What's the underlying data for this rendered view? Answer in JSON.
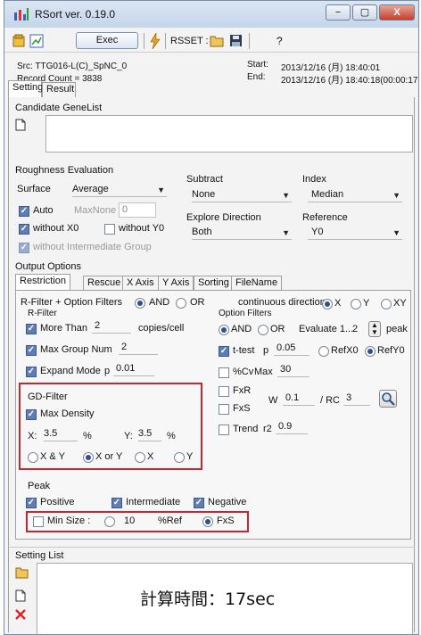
{
  "window": {
    "title": "RSort ver. 0.19.0",
    "minimize": "−",
    "maximize": "▢",
    "close": "X"
  },
  "toolbar": {
    "exec_label": "Exec",
    "rsset_label": "RSSET :",
    "help_label": "?"
  },
  "info": {
    "src": "Src: TTG016-L(C)_SpNC_0",
    "record_count": "Record Count = 3838",
    "start_label": "Start:",
    "start_value": "2013/12/16 (月) 18:40:01",
    "end_label": "End:",
    "end_value": "2013/12/16 (月) 18:40:18(00:00:17"
  },
  "main_tabs": [
    "Setting",
    "Result"
  ],
  "candidate": {
    "label": "Candidate GeneList"
  },
  "roughness": {
    "label": "Roughness Evaluation",
    "surface_label": "Surface",
    "surface_value": "Average",
    "auto_label": "Auto",
    "maxnone_label": "MaxNone",
    "maxnone_value": "0",
    "without_x0": "without X0",
    "without_y0": "without Y0",
    "without_intermediate": "without Intermediate Group",
    "subtract_label": "Subtract",
    "subtract_value": "None",
    "index_label": "Index",
    "index_value": "Median",
    "explore_label": "Explore Direction",
    "explore_value": "Both",
    "reference_label": "Reference",
    "reference_value": "Y0"
  },
  "output": {
    "label": "Output Options"
  },
  "sub_tabs": [
    "Restriction",
    "Rescue",
    "X Axis",
    "Y Axis",
    "Sorting",
    "FileName"
  ],
  "restriction": {
    "rfilter_header": "R-Filter + Option Filters",
    "and": "AND",
    "or": "OR",
    "rfilter_label": "R-Filter",
    "more_than": "More Than",
    "more_than_value": "2",
    "more_than_unit": "copies/cell",
    "max_group": "Max Group Num",
    "max_group_value": "2",
    "expand_mode": "Expand Mode",
    "expand_p": "p",
    "expand_value": "0.01",
    "continuous_direction": "continuous direction",
    "dir_x": "X",
    "dir_y": "Y",
    "dir_xy": "XY",
    "option_filters": "Option Filters",
    "evaluate_label": "Evaluate 1...",
    "evaluate_value": "2",
    "peak_unit": "peak",
    "ttest_label": "t-test",
    "ttest_p": "p",
    "ttest_value": "0.05",
    "refx0": "RefX0",
    "refy0": "RefY0",
    "cv_label": "%Cv",
    "cv_max": "Max",
    "cv_value": "30",
    "fxr": "FxR",
    "fxs": "FxS",
    "w_label": "W",
    "w_value": "0.1",
    "rc_label": "/ RC",
    "rc_value": "3",
    "trend_label": "Trend",
    "trend_r2": "r2",
    "trend_value": "0.9"
  },
  "gd_filter": {
    "label": "GD-Filter",
    "max_density": "Max Density",
    "x_label": "X:",
    "x_value": "3.5",
    "x_unit": "%",
    "y_label": "Y:",
    "y_value": "3.5",
    "y_unit": "%",
    "opts": [
      "X & Y",
      "X or Y",
      "X",
      "Y"
    ]
  },
  "peak": {
    "label": "Peak",
    "positive": "Positive",
    "intermediate": "Intermediate",
    "negative": "Negative"
  },
  "minsize": {
    "label": "Min Size :",
    "value": "10",
    "ref": "%Ref",
    "fxs": "FxS"
  },
  "setting_list": {
    "label": "Setting List"
  },
  "annotation": "計算時間：17sec"
}
